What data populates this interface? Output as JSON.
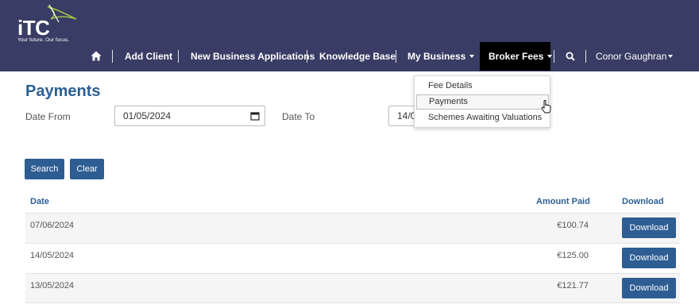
{
  "logo": {
    "text": "iTC",
    "tagline": "Your future. Our focus."
  },
  "nav": {
    "items": [
      {
        "label": "Add Client"
      },
      {
        "label": "New Business Applications"
      },
      {
        "label": "Knowledge Base"
      },
      {
        "label": "My Business"
      },
      {
        "label": "Broker Fees"
      }
    ],
    "user": "Conor Gaughran"
  },
  "page": {
    "title": "Payments"
  },
  "filters": {
    "date_from_label": "Date From",
    "date_from_value": "01/05/2024",
    "date_to_label": "Date To",
    "date_to_value": "14/0"
  },
  "buttons": {
    "search": "Search",
    "clear": "Clear"
  },
  "table": {
    "headers": {
      "date": "Date",
      "amount": "Amount Paid",
      "download": "Download"
    },
    "rows": [
      {
        "date": "07/06/2024",
        "amount": "€100.74",
        "action": "Download"
      },
      {
        "date": "14/05/2024",
        "amount": "€125.00",
        "action": "Download"
      },
      {
        "date": "13/05/2024",
        "amount": "€121.77",
        "action": "Download"
      }
    ]
  },
  "dropdown": {
    "items": [
      {
        "label": "Fee Details"
      },
      {
        "label": "Payments"
      },
      {
        "label": "Schemes Awaiting Valuations"
      }
    ]
  },
  "colors": {
    "navbar": "#393c64",
    "accent": "#2d5d92",
    "title": "#2b5f95",
    "swoosh": "#9cc446"
  }
}
